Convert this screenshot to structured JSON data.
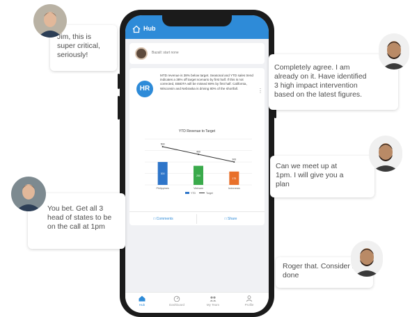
{
  "phone": {
    "header": {
      "title": "Hub",
      "icon": "home-icon",
      "color": "#2e8bd8"
    },
    "post_bar": {
      "placeholder": "Bazall: start none"
    },
    "post": {
      "author_initials": "HR",
      "text": "MTD revenue is 38% below target. Seasonal and YTD sales trend indicates a 38% off target scenario by first half. If this is not corrected, EBIDTA will be missed 69% by first half. California, Wisconsin and Nebraska is driving 80% of the shortfall.",
      "more_icon": "kebab-icon",
      "actions": {
        "comments": "Comments",
        "share": "Share"
      }
    },
    "bottom_nav": [
      {
        "label": "Hub",
        "icon": "home-icon",
        "active": true
      },
      {
        "label": "Dashboard",
        "icon": "gauge-icon",
        "active": false
      },
      {
        "label": "My Team",
        "icon": "team-icon",
        "active": false
      },
      {
        "label": "Profile",
        "icon": "user-icon",
        "active": false
      }
    ]
  },
  "chart_data": {
    "type": "bar",
    "title": "YTD Revenue to Target",
    "categories": [
      "Philippines",
      "Vietnam",
      "Indonesia"
    ],
    "series": [
      {
        "name": "YTD",
        "values": [
          300,
          250,
          175
        ],
        "kind": "bar",
        "colors": [
          "#2e75c9",
          "#3aaa4b",
          "#e8702a"
        ]
      },
      {
        "name": "Target",
        "values": [
          500,
          400,
          300
        ],
        "kind": "line",
        "color": "#333333"
      }
    ],
    "ylim": [
      0,
      600
    ],
    "bar_labels": [
      "300",
      "250",
      "175"
    ],
    "point_labels": [
      "500",
      "400",
      "300"
    ],
    "grid": true,
    "legend": "bottom"
  },
  "chat": [
    {
      "text": "Jim, this is super critical, seriously!",
      "side": "left"
    },
    {
      "text": "Completely agree. I am already on it. Have identified 3 high impact intervention based on the latest figures.",
      "side": "right"
    },
    {
      "text": "Can we meet  up at 1pm. I will give you a plan",
      "side": "right"
    },
    {
      "text": "You bet. Get all 3 head of states to be on the call at 1pm",
      "side": "left"
    },
    {
      "text": "Roger that. Consider it done",
      "side": "right"
    }
  ]
}
